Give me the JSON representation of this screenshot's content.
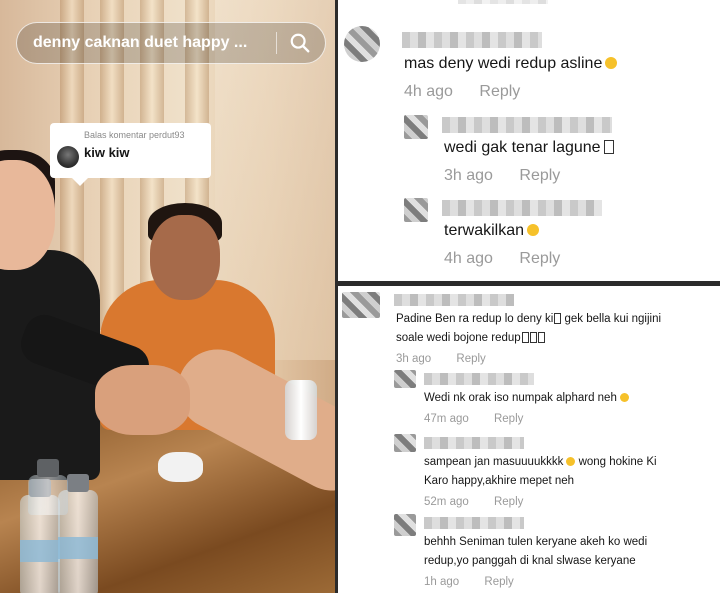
{
  "video": {
    "search_query": "denny caknan duet happy ...",
    "reply_card": {
      "label": "Balas komentar perdut93",
      "text": "kiw kiw"
    }
  },
  "top_panel": {
    "comments": [
      {
        "text": "mas deny wedi redup asline",
        "emoji": "laughing-emoji",
        "time": "4h ago",
        "reply": "Reply"
      },
      {
        "text": "wedi gak tenar lagune",
        "glyph": "missing-glyph-box",
        "time": "3h ago",
        "reply": "Reply"
      },
      {
        "text": "terwakilkan",
        "emoji": "laughing-emoji",
        "time": "4h ago",
        "reply": "Reply"
      }
    ]
  },
  "bottom_panel": {
    "comments": [
      {
        "line1": "Padine Ben ra redup lo deny ki",
        "line1b": "gek bella kui ngijini",
        "line2": "soale wedi bojone redup",
        "time": "3h ago",
        "reply": "Reply"
      },
      {
        "line1": "Wedi nk orak iso numpak alphard neh",
        "time": "47m ago",
        "reply": "Reply"
      },
      {
        "line1": "sampean jan masuuuukkkk",
        "line1b": "wong hokine Ki",
        "line2": "Karo happy,akhire mepet neh",
        "time": "52m ago",
        "reply": "Reply"
      },
      {
        "line1": "behhh Seniman tulen keryane akeh ko wedi",
        "line2": "redup,yo panggah di knal slwase keryane",
        "time": "1h ago",
        "reply": "Reply"
      }
    ]
  },
  "colors": {
    "emoji": "#f6c12a",
    "meta": "#9a9a9a",
    "text": "#161616"
  }
}
